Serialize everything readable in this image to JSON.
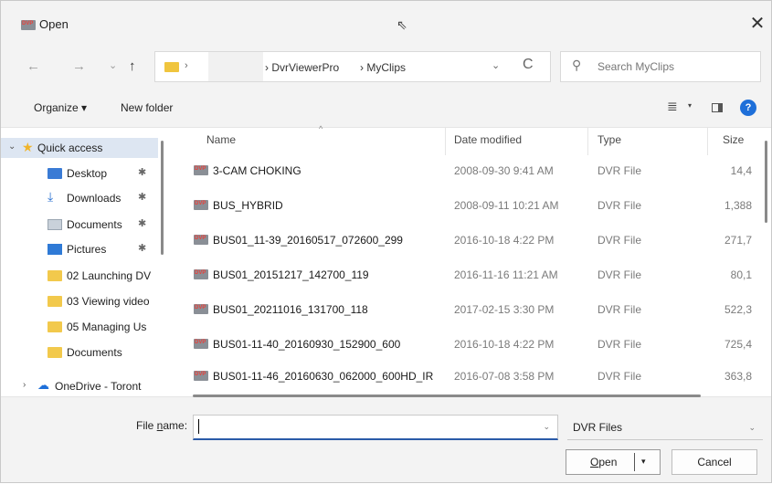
{
  "window": {
    "title": "Open",
    "close_glyph": "✕",
    "pointer_glyph": "⇖"
  },
  "nav": {
    "back": "←",
    "forward": "→",
    "recent": "⌄",
    "up": "↑",
    "address": {
      "sep": "›",
      "crumbs": [
        "› DvrViewerPro",
        "› MyClips"
      ],
      "chevron": "⌄",
      "refresh": "C"
    },
    "search": {
      "placeholder": "Search MyClips",
      "icon_glyph": "⚲"
    }
  },
  "command_bar": {
    "organize": "Organize ▾",
    "new_folder": "New folder",
    "view_glyph": "≣",
    "view_dd": "▾",
    "help_glyph": "?"
  },
  "sidebar": {
    "items": [
      {
        "label": "Quick access",
        "icon": "star-icon",
        "glyph": "★",
        "pinned": false,
        "expander": "⌄"
      },
      {
        "label": "Desktop",
        "icon": "desktop-icon",
        "glyph": "",
        "pinned": true
      },
      {
        "label": "Downloads",
        "icon": "download-icon",
        "glyph": "⤓",
        "pinned": true
      },
      {
        "label": "Documents",
        "icon": "documents-icon",
        "glyph": "",
        "pinned": true
      },
      {
        "label": "Pictures",
        "icon": "pictures-icon",
        "glyph": "",
        "pinned": true
      },
      {
        "label": "02 Launching DV",
        "icon": "folder-icon",
        "glyph": "",
        "pinned": false
      },
      {
        "label": "03 Viewing video",
        "icon": "folder-icon",
        "glyph": "",
        "pinned": false
      },
      {
        "label": "05 Managing Us",
        "icon": "folder-icon",
        "glyph": "",
        "pinned": false
      },
      {
        "label": "Documents",
        "icon": "folder-icon",
        "glyph": "",
        "pinned": false
      },
      {
        "label": "OneDrive - Toront",
        "icon": "cloud-icon",
        "glyph": "☁",
        "pinned": false,
        "expander": "›"
      }
    ],
    "pin_glyph": "✱"
  },
  "file_list": {
    "columns": {
      "name": "Name",
      "date": "Date modified",
      "type": "Type",
      "size": "Size",
      "sort_glyph": "^"
    },
    "rows": [
      {
        "name": "3-CAM CHOKING",
        "date": "2008-09-30 9:41 AM",
        "type": "DVR File",
        "size": "14,4"
      },
      {
        "name": "BUS_HYBRID",
        "date": "2008-09-11 10:21 AM",
        "type": "DVR File",
        "size": "1,388"
      },
      {
        "name": "BUS01_11-39_20160517_072600_299",
        "date": "2016-10-18 4:22 PM",
        "type": "DVR File",
        "size": "271,7"
      },
      {
        "name": "BUS01_20151217_142700_119",
        "date": "2016-11-16 11:21 AM",
        "type": "DVR File",
        "size": "80,1"
      },
      {
        "name": "BUS01_20211016_131700_118",
        "date": "2017-02-15 3:30 PM",
        "type": "DVR File",
        "size": "522,3"
      },
      {
        "name": "BUS01-11-40_20160930_152900_600",
        "date": "2016-10-18 4:22 PM",
        "type": "DVR File",
        "size": "725,4"
      },
      {
        "name": "BUS01-11-46_20160630_062000_600HD_IR",
        "date": "2016-07-08 3:58 PM",
        "type": "DVR File",
        "size": "363,8"
      }
    ]
  },
  "footer": {
    "file_name_label_pre": "File ",
    "file_name_label_u": "n",
    "file_name_label_post": "ame:",
    "file_name_value": "",
    "filter_value": "DVR Files",
    "dd_glyph": "⌄",
    "open_u": "O",
    "open_rest": "pen",
    "open_arrow": "▾",
    "cancel": "Cancel"
  }
}
